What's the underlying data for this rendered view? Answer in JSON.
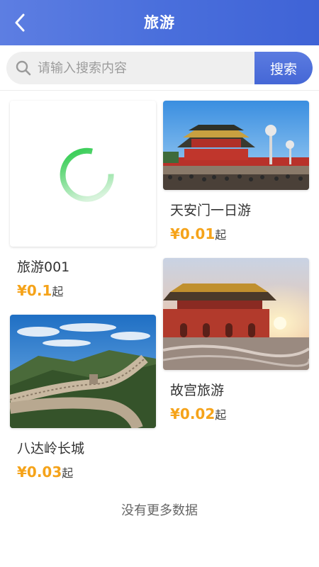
{
  "header": {
    "title": "旅游",
    "back_icon": "chevron-left-icon"
  },
  "search": {
    "placeholder": "请输入搜索内容",
    "value": "",
    "button_label": "搜索",
    "icon": "search-icon"
  },
  "colors": {
    "header": "#4a6fdc",
    "price": "#f5a31a",
    "spinner": "#4cd964"
  },
  "items": [
    {
      "name": "旅游001",
      "price": "¥0.1",
      "price_suffix": "起",
      "image": "loading-spinner"
    },
    {
      "name": "天安门一日游",
      "price": "¥0.01",
      "price_suffix": "起",
      "image": "tiananmen-photo"
    },
    {
      "name": "故宫旅游",
      "price": "¥0.02",
      "price_suffix": "起",
      "image": "forbidden-city-photo"
    },
    {
      "name": "八达岭长城",
      "price": "¥0.03",
      "price_suffix": "起",
      "image": "great-wall-photo"
    }
  ],
  "footer": {
    "no_more": "没有更多数据"
  }
}
